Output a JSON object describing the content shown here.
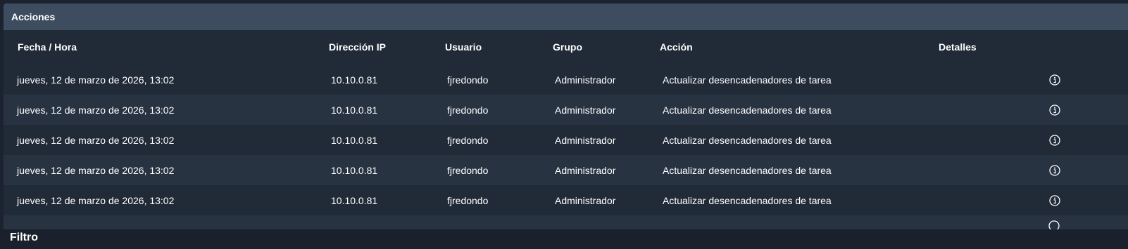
{
  "panel": {
    "title": "Acciones"
  },
  "table": {
    "headers": {
      "datetime": "Fecha / Hora",
      "ip": "Dirección IP",
      "user": "Usuario",
      "group": "Grupo",
      "action": "Acción",
      "details": "Detalles"
    },
    "rows": [
      {
        "datetime": "jueves, 12 de marzo de 2026, 13:02",
        "ip": "10.10.0.81",
        "user": "fjredondo",
        "group": "Administrador",
        "action": "Actualizar desencadenadores de tarea",
        "details_icon": "info-icon"
      },
      {
        "datetime": "jueves, 12 de marzo de 2026, 13:02",
        "ip": "10.10.0.81",
        "user": "fjredondo",
        "group": "Administrador",
        "action": "Actualizar desencadenadores de tarea",
        "details_icon": "info-icon"
      },
      {
        "datetime": "jueves, 12 de marzo de 2026, 13:02",
        "ip": "10.10.0.81",
        "user": "fjredondo",
        "group": "Administrador",
        "action": "Actualizar desencadenadores de tarea",
        "details_icon": "info-icon"
      },
      {
        "datetime": "jueves, 12 de marzo de 2026, 13:02",
        "ip": "10.10.0.81",
        "user": "fjredondo",
        "group": "Administrador",
        "action": "Actualizar desencadenadores de tarea",
        "details_icon": "info-icon"
      },
      {
        "datetime": "jueves, 12 de marzo de 2026, 13:02",
        "ip": "10.10.0.81",
        "user": "fjredondo",
        "group": "Administrador",
        "action": "Actualizar desencadenadores de tarea",
        "details_icon": "info-icon"
      }
    ]
  },
  "filter": {
    "title": "Filtro"
  },
  "colors": {
    "page_bg": "#1c2330",
    "panel_bg": "#212b38",
    "header_bg": "#3d4c5f",
    "row_alt_bg": "#283342",
    "text": "#ffffff"
  }
}
